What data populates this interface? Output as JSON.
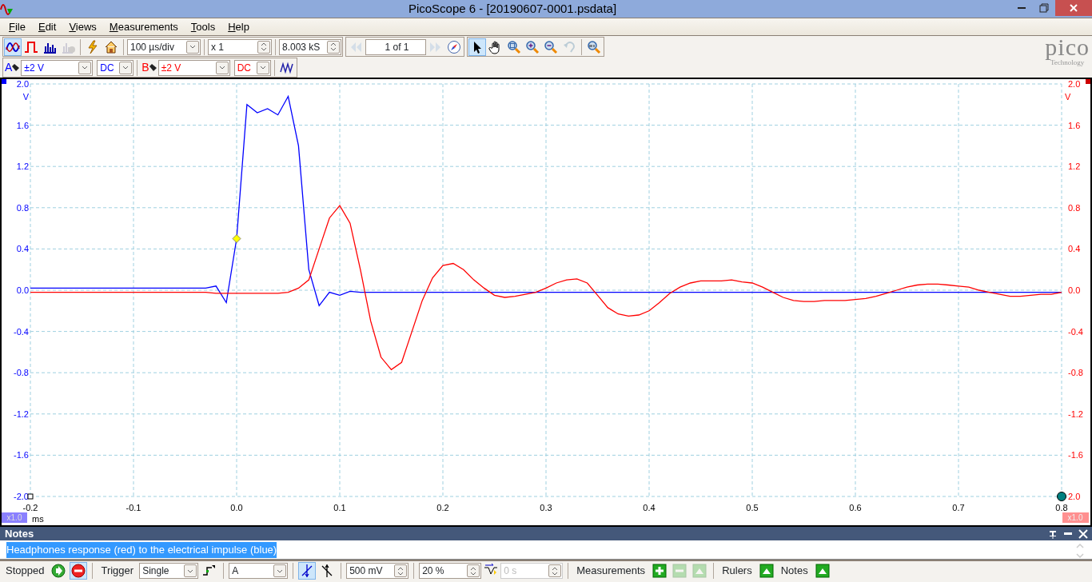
{
  "window": {
    "title": "PicoScope 6 - [20190607-0001.psdata]"
  },
  "menu": [
    {
      "label": "File"
    },
    {
      "label": "Edit"
    },
    {
      "label": "Views"
    },
    {
      "label": "Measurements"
    },
    {
      "label": "Tools"
    },
    {
      "label": "Help"
    }
  ],
  "toolbar": {
    "view_modes": [
      {
        "selected": true,
        "disabled": false
      },
      {
        "selected": false,
        "disabled": false
      },
      {
        "selected": false,
        "disabled": false
      },
      {
        "selected": false,
        "disabled": true
      }
    ],
    "timebase": "100 µs/div",
    "zoom": "x 1",
    "samples": "8.003 kS",
    "buffer": {
      "prev_disabled": true,
      "value": "1 of 1",
      "next_disabled": true
    },
    "tools": [
      {
        "selected": true,
        "disabled": false
      },
      {
        "selected": false,
        "disabled": false
      },
      {
        "selected": false,
        "disabled": false
      },
      {
        "selected": false,
        "disabled": false
      },
      {
        "selected": false,
        "disabled": false
      },
      {
        "selected": false,
        "disabled": true
      },
      {
        "selected": false,
        "disabled": false
      }
    ]
  },
  "logo": {
    "name": "pico",
    "tagline": "Technology"
  },
  "channels": [
    {
      "name": "A",
      "range": "±2 V",
      "coupling": "DC",
      "color": "#0000ff"
    },
    {
      "name": "B",
      "range": "±2 V",
      "coupling": "DC",
      "color": "#ff0000"
    }
  ],
  "chart": {
    "left_unit": "V",
    "left_scale": "x1.0",
    "right_unit": "V",
    "right_scale": "x1.0",
    "right_ticks": [
      "2.0",
      "1.6",
      "1.2",
      "0.8",
      "0.4",
      "0.0",
      "-0.4",
      "-0.8",
      "-1.2",
      "-1.6",
      "2.0"
    ],
    "chart_data": {
      "type": "line",
      "grid": true,
      "xlabel": "ms",
      "xlim": [
        -0.2,
        0.8
      ],
      "ylim": [
        -2,
        2
      ],
      "xticks": [
        {
          "value": -0.2,
          "label": "-0.2"
        },
        {
          "value": -0.1,
          "label": "-0.1"
        },
        {
          "value": 0,
          "label": "0.0"
        },
        {
          "value": 0.1,
          "label": "0.1"
        },
        {
          "value": 0.2,
          "label": "0.2"
        },
        {
          "value": 0.3,
          "label": "0.3"
        },
        {
          "value": 0.4,
          "label": "0.4"
        },
        {
          "value": 0.5,
          "label": "0.5"
        },
        {
          "value": 0.6,
          "label": "0.6"
        },
        {
          "value": 0.7,
          "label": "0.7"
        },
        {
          "value": 0.8,
          "label": "0.8"
        }
      ],
      "yticks": [
        {
          "value": 2,
          "label": "2.0"
        },
        {
          "value": 1.6,
          "label": "1.6"
        },
        {
          "value": 1.2,
          "label": "1.2"
        },
        {
          "value": 0.8,
          "label": "0.8"
        },
        {
          "value": 0.4,
          "label": "0.4"
        },
        {
          "value": 0,
          "label": "0.0"
        },
        {
          "value": -0.4,
          "label": "-0.4"
        },
        {
          "value": -0.8,
          "label": "-0.8"
        },
        {
          "value": -1.2,
          "label": "-1.2"
        },
        {
          "value": -1.6,
          "label": "-1.6"
        },
        {
          "value": -2,
          "label": "-2.0"
        }
      ],
      "x": [
        -0.2,
        -0.19,
        -0.18,
        -0.17,
        -0.16,
        -0.15,
        -0.14,
        -0.13,
        -0.12,
        -0.11,
        -0.1,
        -0.09,
        -0.08,
        -0.07,
        -0.06,
        -0.05,
        -0.04,
        -0.03,
        -0.02,
        -0.01,
        0,
        0.01,
        0.02,
        0.03,
        0.04,
        0.05,
        0.06,
        0.07,
        0.08,
        0.09,
        0.1,
        0.11,
        0.12,
        0.13,
        0.14,
        0.15,
        0.16,
        0.17,
        0.18,
        0.19,
        0.2,
        0.21,
        0.22,
        0.23,
        0.24,
        0.25,
        0.26,
        0.27,
        0.28,
        0.29,
        0.3,
        0.31,
        0.32,
        0.33,
        0.34,
        0.35,
        0.36,
        0.37,
        0.38,
        0.39,
        0.4,
        0.41,
        0.42,
        0.43,
        0.44,
        0.45,
        0.46,
        0.47,
        0.48,
        0.49,
        0.5,
        0.51,
        0.52,
        0.53,
        0.54,
        0.55,
        0.56,
        0.57,
        0.58,
        0.59,
        0.6,
        0.61,
        0.62,
        0.63,
        0.64,
        0.65,
        0.66,
        0.67,
        0.68,
        0.69,
        0.7,
        0.71,
        0.72,
        0.73,
        0.74,
        0.75,
        0.76,
        0.77,
        0.78,
        0.79,
        0.8
      ],
      "series": [
        {
          "color": "#0000ff",
          "values": [
            0.02,
            0.02,
            0.02,
            0.02,
            0.02,
            0.02,
            0.02,
            0.02,
            0.02,
            0.02,
            0.02,
            0.02,
            0.02,
            0.02,
            0.02,
            0.02,
            0.02,
            0.02,
            0.04,
            -0.12,
            0.5,
            1.8,
            1.72,
            1.76,
            1.7,
            1.88,
            1.4,
            0.2,
            -0.15,
            -0.02,
            -0.05,
            -0.01,
            -0.02,
            -0.02,
            -0.02,
            -0.02,
            -0.02,
            -0.02,
            -0.02,
            -0.02,
            -0.02,
            -0.02,
            -0.02,
            -0.02,
            -0.02,
            -0.02,
            -0.02,
            -0.02,
            -0.02,
            -0.02,
            -0.02,
            -0.02,
            -0.02,
            -0.02,
            -0.02,
            -0.02,
            -0.02,
            -0.02,
            -0.02,
            -0.02,
            -0.02,
            -0.02,
            -0.02,
            -0.02,
            -0.02,
            -0.02,
            -0.02,
            -0.02,
            -0.02,
            -0.02,
            -0.02,
            -0.02,
            -0.02,
            -0.02,
            -0.02,
            -0.02,
            -0.02,
            -0.02,
            -0.02,
            -0.02,
            -0.02,
            -0.02,
            -0.02,
            -0.02,
            -0.02,
            -0.02,
            -0.02,
            -0.02,
            -0.02,
            -0.02,
            -0.02,
            -0.02,
            -0.02,
            -0.02,
            -0.02,
            -0.02,
            -0.02,
            -0.02,
            -0.02,
            -0.02,
            -0.02
          ]
        },
        {
          "color": "#ff0000",
          "values": [
            -0.02,
            -0.02,
            -0.02,
            -0.02,
            -0.02,
            -0.02,
            -0.02,
            -0.02,
            -0.02,
            -0.02,
            -0.02,
            -0.02,
            -0.02,
            -0.02,
            -0.02,
            -0.02,
            -0.02,
            -0.02,
            -0.03,
            -0.03,
            -0.03,
            -0.03,
            -0.03,
            -0.03,
            -0.03,
            -0.02,
            0.02,
            0.1,
            0.4,
            0.7,
            0.82,
            0.65,
            0.2,
            -0.3,
            -0.65,
            -0.77,
            -0.7,
            -0.4,
            -0.1,
            0.12,
            0.24,
            0.26,
            0.2,
            0.1,
            0.02,
            -0.05,
            -0.07,
            -0.06,
            -0.04,
            -0.02,
            0.02,
            0.07,
            0.1,
            0.11,
            0.07,
            -0.05,
            -0.17,
            -0.23,
            -0.25,
            -0.24,
            -0.2,
            -0.12,
            -0.03,
            0.03,
            0.07,
            0.09,
            0.09,
            0.09,
            0.1,
            0.08,
            0.07,
            0.03,
            -0.02,
            -0.07,
            -0.1,
            -0.11,
            -0.11,
            -0.1,
            -0.1,
            -0.1,
            -0.09,
            -0.08,
            -0.06,
            -0.03,
            0,
            0.03,
            0.05,
            0.06,
            0.06,
            0.05,
            0.04,
            0.03,
            0,
            -0.02,
            -0.04,
            -0.06,
            -0.06,
            -0.05,
            -0.04,
            -0.04,
            -0.02
          ]
        }
      ]
    }
  },
  "notes": {
    "title": "Notes",
    "text": "Headphones response (red) to the electrical impulse (blue)",
    "selected": true
  },
  "status": {
    "state": "Stopped",
    "running": false,
    "trigger_label": "Trigger",
    "trigger_mode": "Single",
    "source": "A",
    "edges": [
      {
        "selected": true
      },
      {
        "selected": false
      }
    ],
    "threshold": "500 mV",
    "pretrigger": "20 %",
    "delay": "0 s",
    "delay_disabled": true,
    "measurements_label": "Measurements",
    "measure_buttons": [
      {
        "disabled": false
      },
      {
        "disabled": true
      },
      {
        "disabled": true
      }
    ],
    "rulers_label": "Rulers",
    "notes_label": "Notes"
  }
}
